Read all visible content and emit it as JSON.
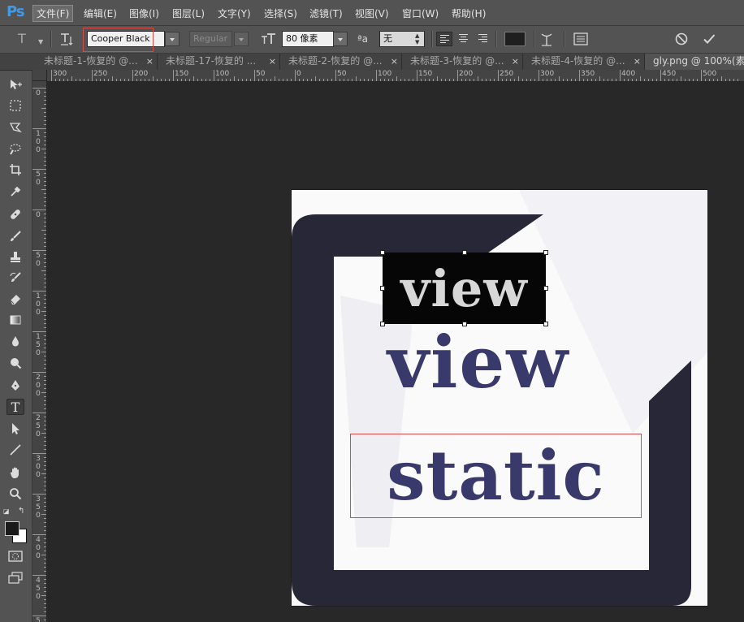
{
  "app": {
    "logo": "Ps"
  },
  "menu": [
    {
      "label": "文件(F)",
      "active": true
    },
    {
      "label": "编辑(E)"
    },
    {
      "label": "图像(I)"
    },
    {
      "label": "图层(L)"
    },
    {
      "label": "文字(Y)"
    },
    {
      "label": "选择(S)"
    },
    {
      "label": "滤镜(T)"
    },
    {
      "label": "视图(V)"
    },
    {
      "label": "窗口(W)"
    },
    {
      "label": "帮助(H)"
    }
  ],
  "options": {
    "tool_icon": "T",
    "font_family": "Cooper Black",
    "font_style": "Regular",
    "font_size": "80 像素",
    "antialias_icon": "ªa",
    "antialias": "无",
    "text_color": "#1f1f1f"
  },
  "tabs": [
    {
      "label": "未标题-1-恢复的 @...",
      "close": "×"
    },
    {
      "label": "未标题-17-恢复的 ...",
      "close": "×"
    },
    {
      "label": "未标题-2-恢复的 @...",
      "close": "×"
    },
    {
      "label": "未标题-3-恢复的 @...",
      "close": "×"
    },
    {
      "label": "未标题-4-恢复的 @...",
      "close": "×"
    },
    {
      "label": "gly.png @ 100%(素..."
    }
  ],
  "ruler_top": [
    "300",
    "250",
    "200",
    "150",
    "100",
    "50",
    "0",
    "50",
    "100",
    "150",
    "200",
    "250",
    "300",
    "350",
    "400",
    "450",
    "500"
  ],
  "ruler_left": [
    "0",
    "100",
    "50",
    "0",
    "50",
    "100",
    "150",
    "200",
    "250",
    "300",
    "350",
    "400",
    "450",
    "500"
  ],
  "canvas": {
    "text_top": "view",
    "text_middle": "view",
    "text_bottom": "static"
  },
  "colors": {
    "accent": "#3d9be9",
    "frame_dark": "#272738",
    "text_navy": "#39396b",
    "selection_red": "#d94a4a",
    "foreground": "#1a1a1a",
    "background": "#ffffff"
  },
  "toolbox": [
    "move-tool-icon",
    "marquee-tool-icon",
    "lasso-tool-icon",
    "quick-selection-tool-icon",
    "crop-tool-icon",
    "eyedropper-tool-icon",
    "healing-brush-tool-icon",
    "brush-tool-icon",
    "clone-stamp-tool-icon",
    "history-brush-tool-icon",
    "eraser-tool-icon",
    "gradient-tool-icon",
    "blur-tool-icon",
    "dodge-tool-icon",
    "pen-tool-icon",
    "type-tool-icon",
    "path-selection-tool-icon",
    "line-tool-icon",
    "hand-tool-icon",
    "zoom-tool-icon"
  ]
}
